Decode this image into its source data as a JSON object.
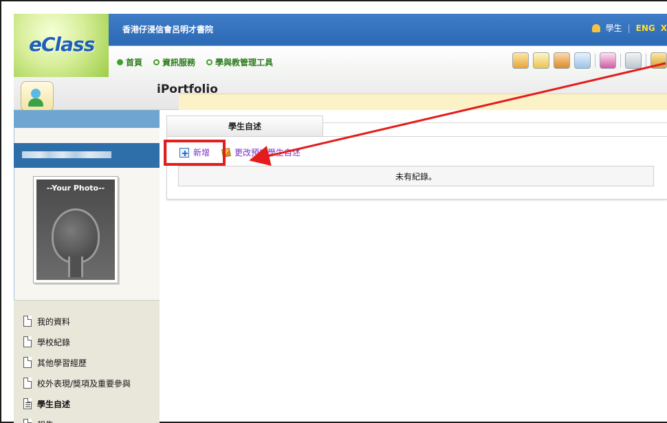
{
  "header": {
    "logo_text": "eClass",
    "school_name": "香港仔浸信會呂明才書院",
    "user_role": "學生",
    "language": "ENG",
    "nav": [
      {
        "label": "首頁"
      },
      {
        "label": "資訊服務"
      },
      {
        "label": "學與教管理工具"
      }
    ],
    "toolbar_icons": [
      "book-icon",
      "calendar-icon",
      "new-badge-icon",
      "notes-icon",
      "globe-icon",
      "pen-icon",
      "download-icon"
    ]
  },
  "module": {
    "title": "iPortfolio"
  },
  "sidebar": {
    "photo_label": "--Your Photo--",
    "menu": [
      {
        "label": "我的資料",
        "active": false
      },
      {
        "label": "學校紀錄",
        "active": false
      },
      {
        "label": "其他學習經歷",
        "active": false
      },
      {
        "label": "校外表現/獎項及重要參與",
        "active": false
      },
      {
        "label": "學生自述",
        "active": true
      },
      {
        "label": "報告",
        "active": false
      }
    ]
  },
  "content": {
    "tab_label": "學生自述",
    "add_label": "新增",
    "change_label": "更改預設學生自述",
    "empty_text": "未有紀錄。"
  },
  "colors": {
    "header_blue": "#2f6db9",
    "nav_green": "#2a7a1c",
    "link_purple": "#7a33c8",
    "highlight_red": "#e41c1c"
  }
}
